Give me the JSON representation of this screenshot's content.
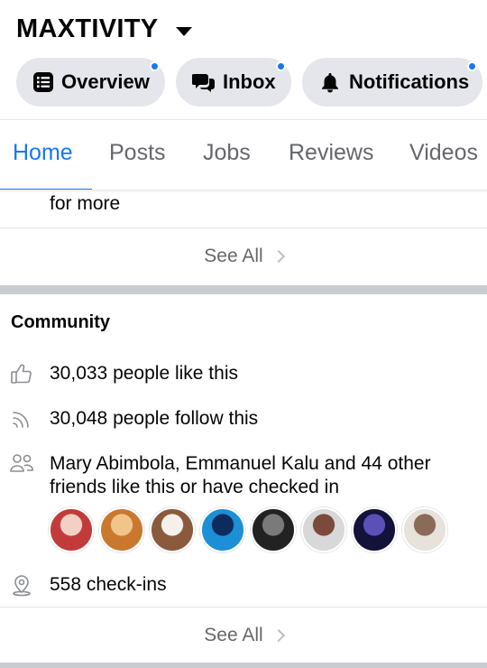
{
  "header": {
    "page_title": "MAXTIVITY",
    "pills": [
      {
        "label": "Overview",
        "icon": "list-icon",
        "has_dot": true
      },
      {
        "label": "Inbox",
        "icon": "chat-bubbles-icon",
        "has_dot": true
      },
      {
        "label": "Notifications",
        "icon": "bell-icon",
        "has_dot": true
      }
    ]
  },
  "tabs": [
    {
      "label": "Home",
      "active": true
    },
    {
      "label": "Posts",
      "active": false
    },
    {
      "label": "Jobs",
      "active": false
    },
    {
      "label": "Reviews",
      "active": false
    },
    {
      "label": "Videos",
      "active": false
    }
  ],
  "about_section": {
    "truncated_text": "for more",
    "see_all": "See All"
  },
  "community": {
    "title": "Community",
    "likes": "30,033 people like this",
    "follows": "30,048 people follow this",
    "friends_line1": "Mary Abimbola, Emmanuel Kalu and 44 other",
    "friends_line2": "friends like this or have checked in",
    "avatars": [
      {
        "name": "friend-avatar-1",
        "colors": [
          "#c23b3b",
          "#f2d0c4"
        ]
      },
      {
        "name": "friend-avatar-2",
        "colors": [
          "#c9792e",
          "#f0c48a"
        ]
      },
      {
        "name": "friend-avatar-3",
        "colors": [
          "#8a5a3c",
          "#f5f0ea"
        ]
      },
      {
        "name": "friend-avatar-4",
        "colors": [
          "#1c8fd6",
          "#0d2c5c"
        ]
      },
      {
        "name": "friend-avatar-5",
        "colors": [
          "#222222",
          "#7a7a7a"
        ]
      },
      {
        "name": "friend-avatar-6",
        "colors": [
          "#d8d8d8",
          "#7c4a3a"
        ]
      },
      {
        "name": "friend-avatar-7",
        "colors": [
          "#12123a",
          "#5b4fb8"
        ]
      },
      {
        "name": "friend-avatar-8",
        "colors": [
          "#e7e2dc",
          "#8a6a58"
        ]
      }
    ],
    "checkins": "558 check-ins",
    "see_all": "See All"
  },
  "colors": {
    "accent": "#1877f2",
    "pill_bg": "#e4e6eb",
    "secondary_text": "#65676b",
    "separator": "#c9ccd1"
  }
}
